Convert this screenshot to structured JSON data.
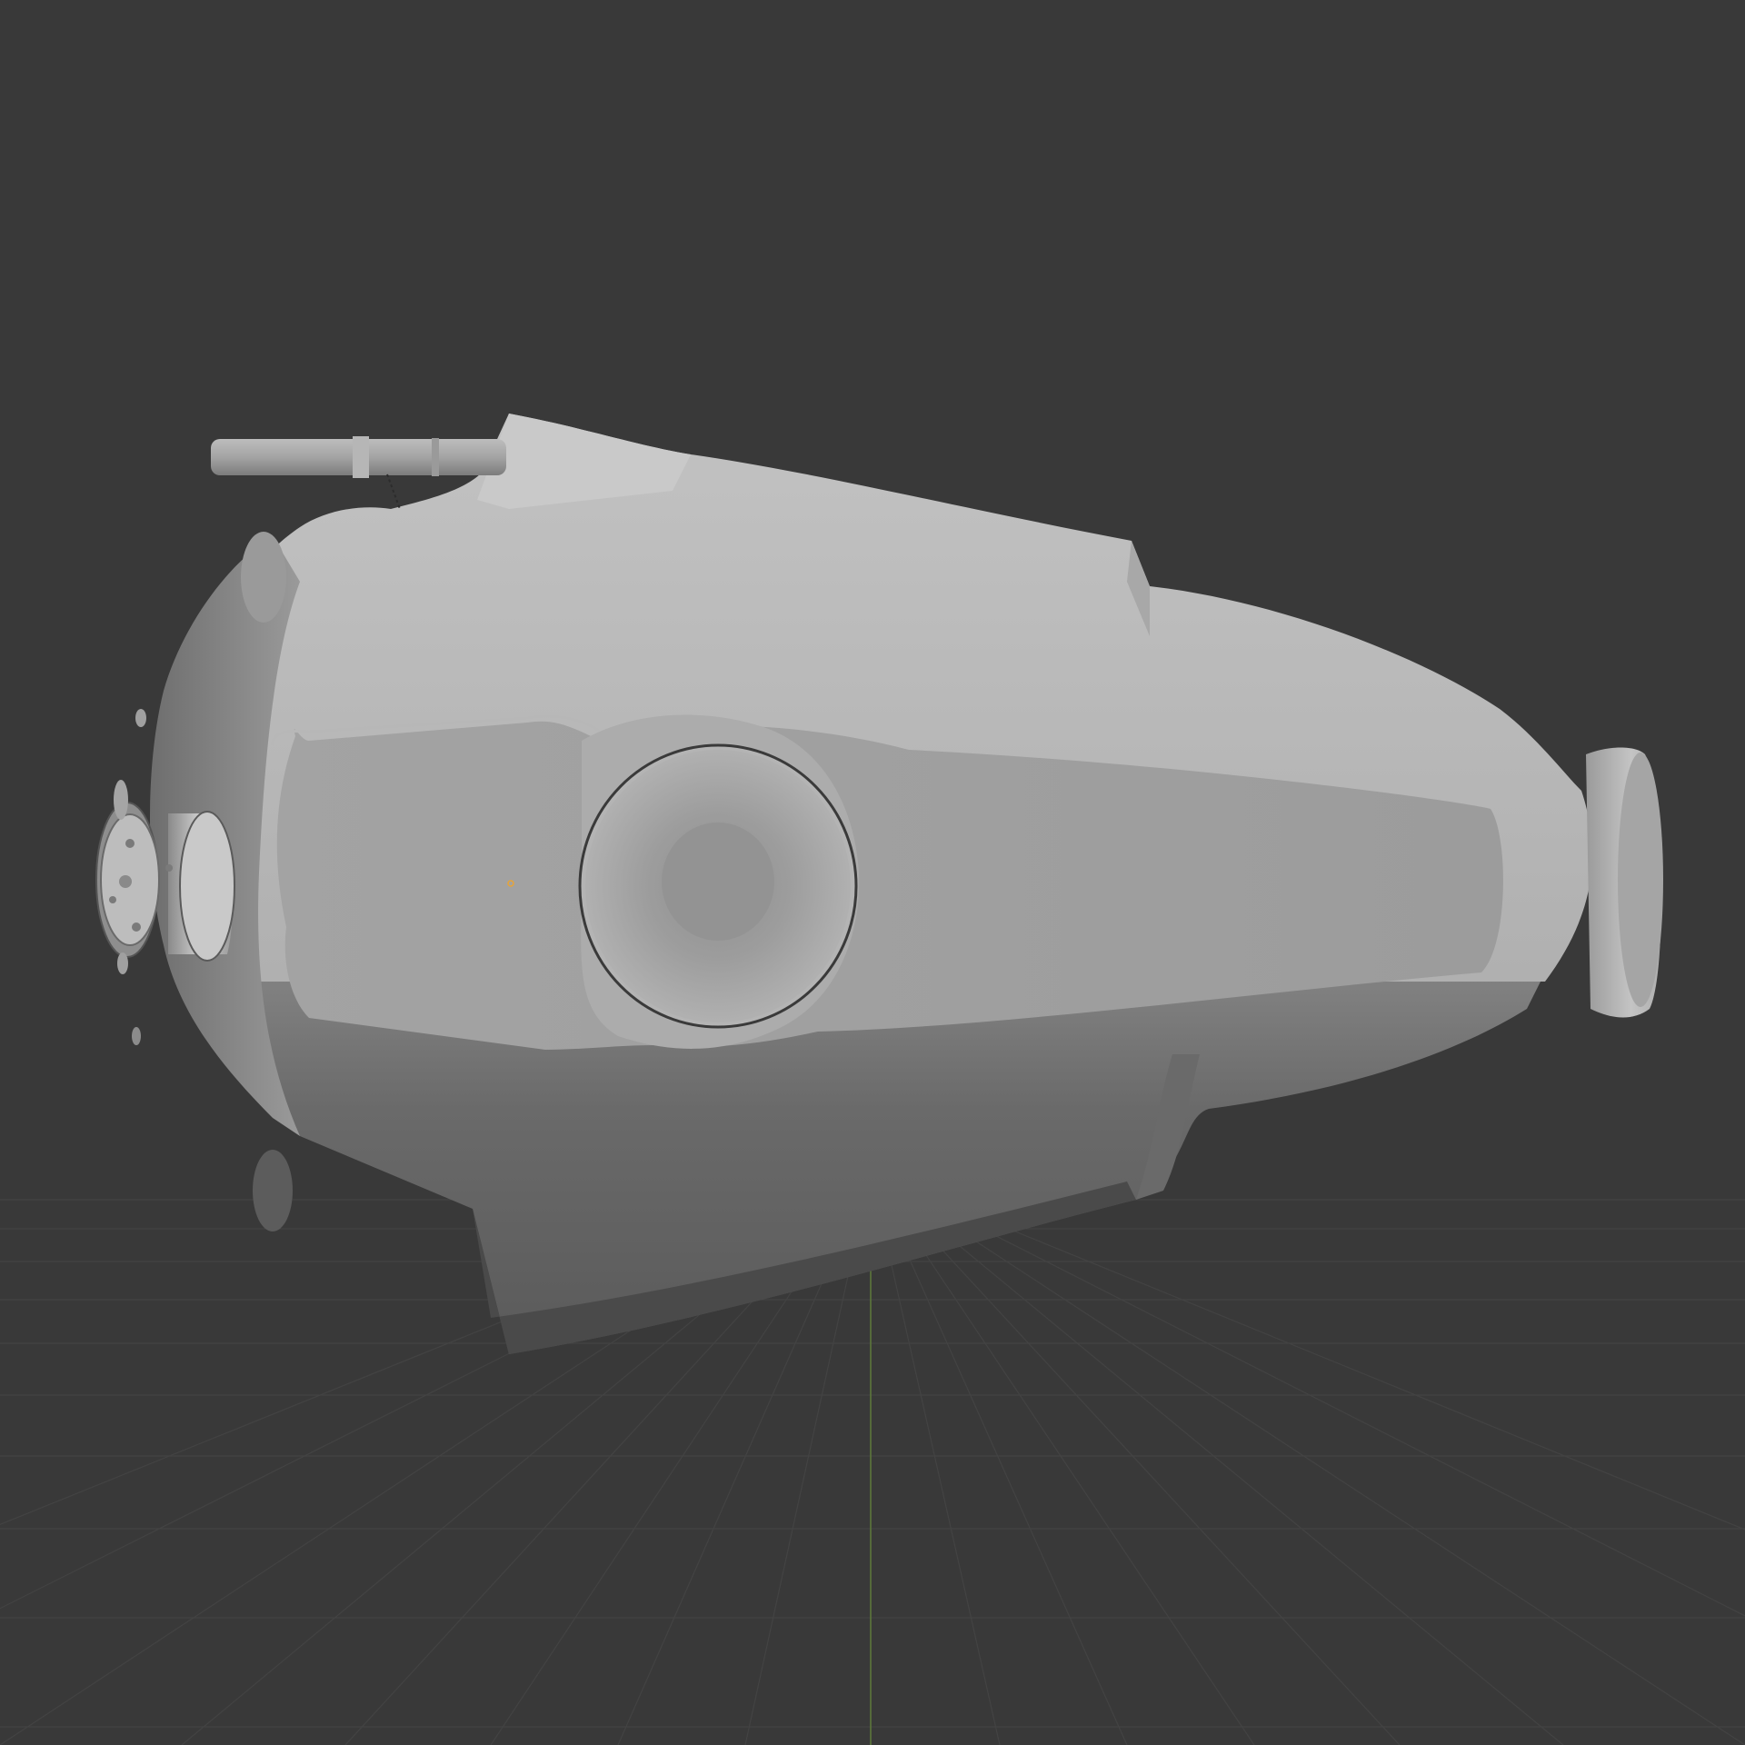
{
  "app": {
    "view": "3d-viewport",
    "shading_mode": "solid"
  },
  "viewport": {
    "background_color": "#393939",
    "grid_color": "#434343",
    "grid_visible": true,
    "axis_y_color": "#5f7a3a",
    "model_base_color": "#b0b0b0",
    "origin_marker_color": "#e8a436"
  },
  "scene": {
    "objects": [
      {
        "name": "hull-body",
        "icon": "mesh-icon"
      },
      {
        "name": "top-pipe",
        "icon": "cylinder-icon"
      },
      {
        "name": "front-flange",
        "icon": "cylinder-icon"
      },
      {
        "name": "center-porthole",
        "icon": "circle-icon"
      },
      {
        "name": "rear-nozzle",
        "icon": "cylinder-icon"
      }
    ]
  }
}
